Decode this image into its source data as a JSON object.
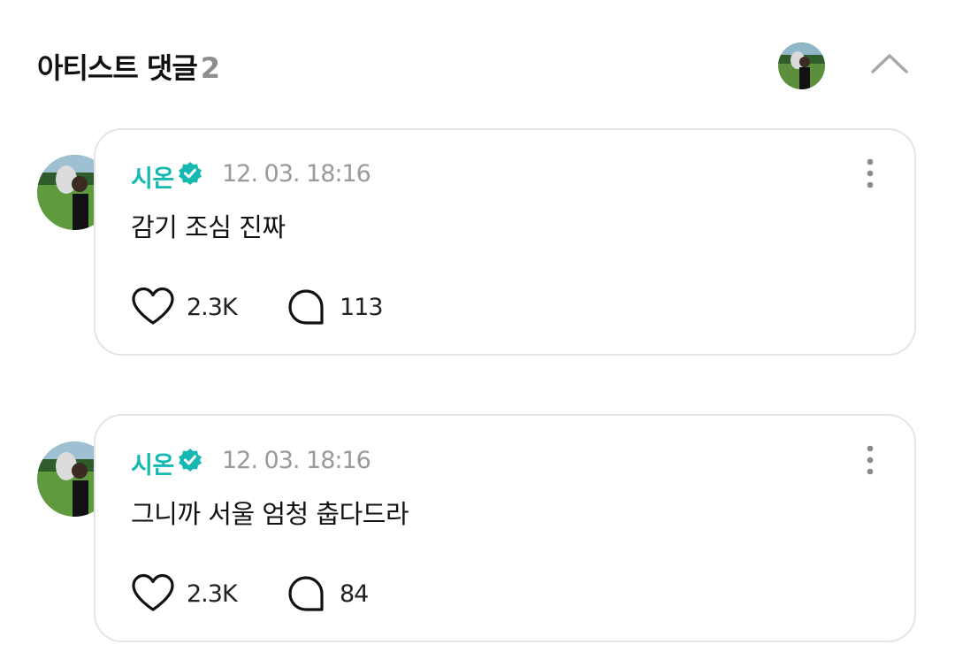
{
  "header": {
    "title": "아티스트 댓글",
    "count": "2",
    "avatar_icon": "user-avatar-photo",
    "collapse_icon": "chevron-up-icon"
  },
  "colors": {
    "accent": "#16b9b2",
    "muted": "#9a9a9a",
    "card_border": "#e4e4e4"
  },
  "comments": [
    {
      "author": "시온",
      "verified_icon": "verified-badge-icon",
      "timestamp": "12. 03. 18:16",
      "text": "감기 조심 진짜",
      "likes": "2.3K",
      "replies": "113"
    },
    {
      "author": "시온",
      "verified_icon": "verified-badge-icon",
      "timestamp": "12. 03. 18:16",
      "text": "그니까 서울 엄청 춥다드라",
      "likes": "2.3K",
      "replies": "84"
    }
  ]
}
